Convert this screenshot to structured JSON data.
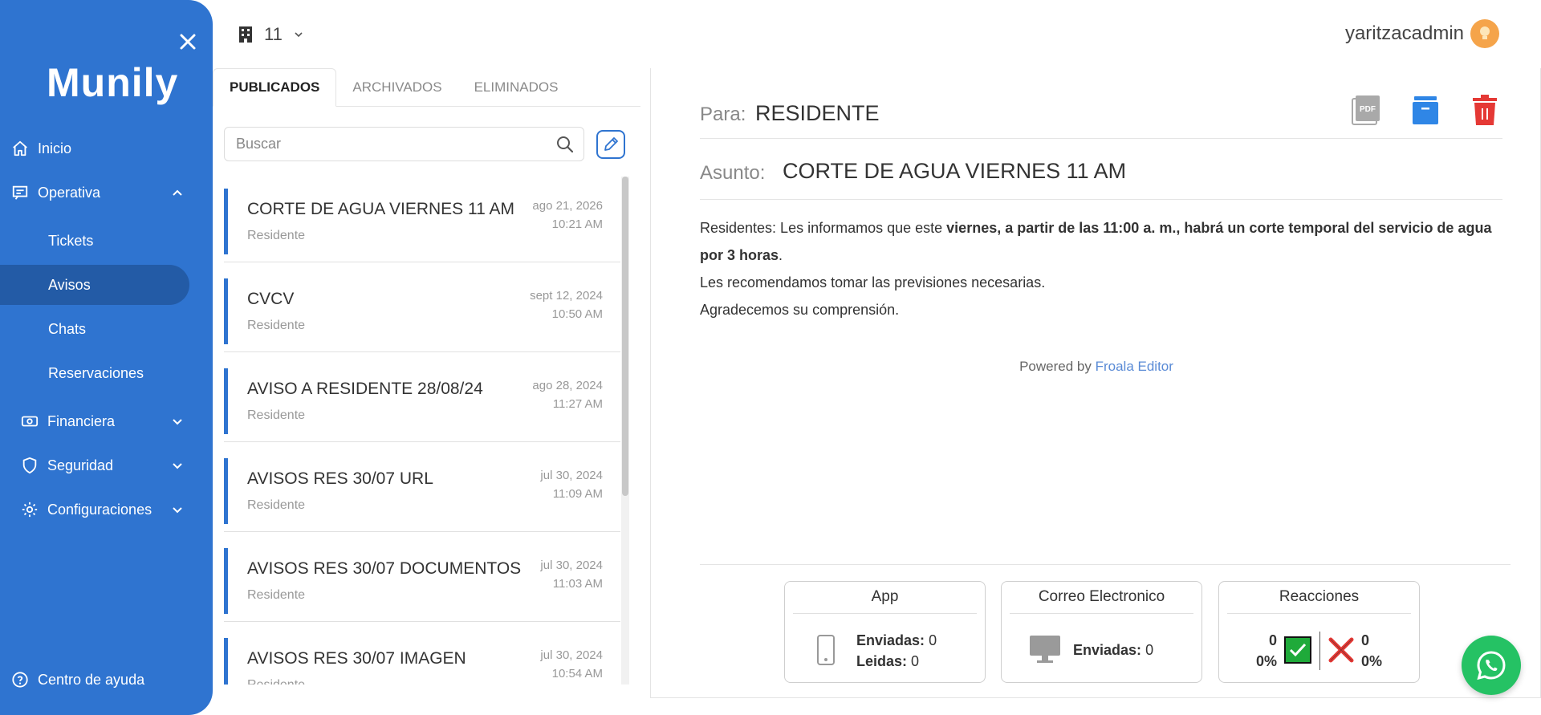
{
  "sidebar": {
    "logo": "Munily",
    "items": {
      "inicio": "Inicio",
      "operativa": "Operativa",
      "tickets": "Tickets",
      "avisos": "Avisos",
      "chats": "Chats",
      "reservaciones": "Reservaciones",
      "financiera": "Financiera",
      "seguridad": "Seguridad",
      "configuraciones": "Configuraciones"
    },
    "help": "Centro de ayuda",
    "active_item": "Avisos"
  },
  "topbar": {
    "building_number": "11",
    "username": "yaritzacadmin"
  },
  "tabs": [
    "PUBLICADOS",
    "ARCHIVADOS",
    "ELIMINADOS"
  ],
  "active_tab": "PUBLICADOS",
  "search": {
    "placeholder": "Buscar",
    "value": ""
  },
  "notices": [
    {
      "title": "CORTE DE AGUA VIERNES 11 AM",
      "recipient": "Residente",
      "date": "ago 21, 2026",
      "time": "10:21 AM"
    },
    {
      "title": "CVCV",
      "recipient": "Residente",
      "date": "sept 12, 2024",
      "time": "10:50 AM"
    },
    {
      "title": "AVISO A RESIDENTE 28/08/24",
      "recipient": "Residente",
      "date": "ago 28, 2024",
      "time": "11:27 AM"
    },
    {
      "title": "AVISOS RES 30/07 URL",
      "recipient": "Residente",
      "date": "jul 30, 2024",
      "time": "11:09 AM"
    },
    {
      "title": "AVISOS RES 30/07 DOCUMENTOS",
      "recipient": "Residente",
      "date": "jul 30, 2024",
      "time": "11:03 AM"
    },
    {
      "title": "AVISOS RES 30/07 IMAGEN",
      "recipient": "Residente",
      "date": "jul 30, 2024",
      "time": "10:54 AM"
    }
  ],
  "detail": {
    "para_label": "Para:",
    "para_value": "RESIDENTE",
    "asunto_label": "Asunto:",
    "asunto_value": "CORTE DE AGUA VIERNES 11 AM",
    "body": {
      "intro": "Residentes: Les informamos que este ",
      "bold": "viernes, a partir de las 11:00 a. m., habrá un corte temporal del servicio de agua por 3 horas",
      "period": ".",
      "line2": "Les recomendamos tomar las previsiones necesarias.",
      "line3": "Agradecemos su comprensión."
    },
    "powered_by": "Powered by",
    "powered_link": "Froala Editor",
    "pdf_label": "PDF"
  },
  "stats": {
    "app": {
      "title": "App",
      "sent_label": "Enviadas:",
      "sent": "0",
      "read_label": "Leidas:",
      "read": "0"
    },
    "email": {
      "title": "Correo Electronico",
      "sent_label": "Enviadas:",
      "sent": "0"
    },
    "reactions": {
      "title": "Reacciones",
      "positive_count": "0",
      "positive_pct": "0%",
      "negative_count": "0",
      "negative_pct": "0%"
    }
  },
  "colors": {
    "sidebar": "#2f74d0",
    "sidebar_active": "#235ba6",
    "accent": "#2f74d0",
    "delete": "#e53935",
    "whatsapp": "#25c264"
  },
  "icons": {
    "close": "close-icon",
    "home": "home-icon",
    "operativa": "message-square-icon",
    "financiera": "money-icon",
    "seguridad": "shield-icon",
    "configuraciones": "gear-icon",
    "help": "help-circle-icon",
    "building": "building-icon",
    "search": "search-icon",
    "edit": "pencil-icon",
    "pdf": "pdf-icon",
    "archive": "archive-icon",
    "delete": "trash-icon",
    "phone": "phone-icon",
    "monitor": "monitor-icon",
    "check": "check-icon",
    "cross": "x-icon",
    "whatsapp": "whatsapp-icon"
  }
}
